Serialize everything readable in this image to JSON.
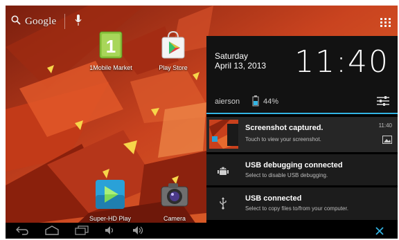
{
  "search": {
    "label": "Google",
    "icon": "search-icon",
    "mic_icon": "mic-icon"
  },
  "apps_button": {
    "icon": "apps-grid-icon"
  },
  "desktop": {
    "apps": [
      {
        "label": "1Mobile Market",
        "icon": "1mobile-market-icon"
      },
      {
        "label": "Play Store",
        "icon": "play-store-icon"
      },
      {
        "label": "Super-HD Play",
        "icon": "super-hd-play-icon"
      },
      {
        "label": "Camera",
        "icon": "camera-icon"
      }
    ]
  },
  "notification_panel": {
    "day": "Saturday",
    "date": "April 13, 2013",
    "time": "11:40",
    "carrier": "aierson",
    "battery_percent": "44%",
    "notifications": [
      {
        "title": "Screenshot captured.",
        "subtitle": "Touch to view your screenshot.",
        "time": "11:40",
        "icon": "screenshot-thumbnail"
      },
      {
        "title": "USB debugging connected",
        "subtitle": "Select to disable USB debugging.",
        "icon": "android-debug-icon"
      },
      {
        "title": "USB connected",
        "subtitle": "Select to copy files to/from your computer.",
        "icon": "usb-icon"
      }
    ]
  },
  "navbar": {
    "icons": [
      "back-icon",
      "home-icon",
      "recent-apps-icon",
      "volume-down-icon",
      "volume-up-icon",
      "close-panel-icon"
    ]
  },
  "colors": {
    "accent": "#33b5e5",
    "panel_bg": "#121212",
    "notif_bg": "#1c1c1c",
    "wallpaper": "#b2381c"
  }
}
